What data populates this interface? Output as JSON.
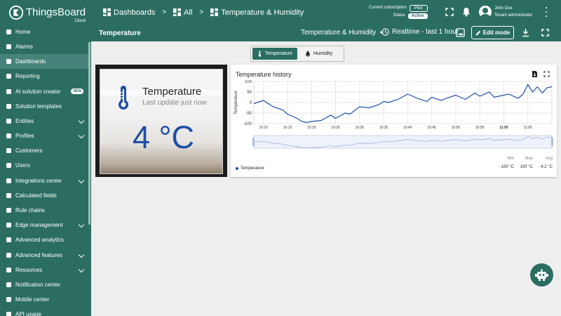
{
  "app": {
    "brand": "ThingsBoard",
    "edition": "Cloud"
  },
  "breadcrumb": [
    {
      "label": "Dashboards",
      "icon": "dashboard-icon"
    },
    {
      "label": "All",
      "icon": "dashboard-icon"
    },
    {
      "label": "Temperature & Humidity",
      "icon": "dashboard-icon"
    }
  ],
  "subscription": {
    "label": "Current subscription",
    "plan": "Pilot",
    "status_label": "Status",
    "status": "Active"
  },
  "user": {
    "name": "John Doe",
    "role": "Tenant administrator"
  },
  "sidebar": {
    "items": [
      {
        "label": "Home",
        "icon": "home-icon",
        "chevron": false
      },
      {
        "label": "Alarms",
        "icon": "alarm-icon",
        "chevron": false
      },
      {
        "label": "Dashboards",
        "icon": "dashboard-icon",
        "chevron": false,
        "active": true
      },
      {
        "label": "Reporting",
        "icon": "report-icon",
        "chevron": false
      },
      {
        "label": "AI solution creator",
        "icon": "ai-icon",
        "chevron": false,
        "badge": "NEW"
      },
      {
        "label": "Solution templates",
        "icon": "template-icon",
        "chevron": false
      },
      {
        "label": "Entities",
        "icon": "entities-icon",
        "chevron": true
      },
      {
        "label": "Profiles",
        "icon": "profiles-icon",
        "chevron": true
      },
      {
        "label": "Customers",
        "icon": "customers-icon",
        "chevron": false
      },
      {
        "label": "Users",
        "icon": "users-icon",
        "chevron": false
      },
      {
        "label": "Integrations center",
        "icon": "integrations-icon",
        "chevron": true
      },
      {
        "label": "Calculated fields",
        "icon": "calculator-icon",
        "chevron": false
      },
      {
        "label": "Rule chains",
        "icon": "rule-chain-icon",
        "chevron": false
      },
      {
        "label": "Edge management",
        "icon": "edge-icon",
        "chevron": true
      },
      {
        "label": "Advanced analytics",
        "icon": "analytics-icon",
        "chevron": false
      },
      {
        "label": "Advanced features",
        "icon": "tools-icon",
        "chevron": true
      },
      {
        "label": "Resources",
        "icon": "folder-icon",
        "chevron": true
      },
      {
        "label": "Notification center",
        "icon": "notification-icon",
        "chevron": false
      },
      {
        "label": "Mobile center",
        "icon": "mobile-icon",
        "chevron": false
      },
      {
        "label": "API usage",
        "icon": "api-icon",
        "chevron": false
      }
    ]
  },
  "dashboard": {
    "title": "Temperature",
    "state": "Temperature & Humidity",
    "timewindow": "Realtime - last 1 hour",
    "edit_label": "Edit mode"
  },
  "tabs": [
    {
      "label": "Temperature",
      "icon": "thermometer-icon",
      "active": true
    },
    {
      "label": "Humidity",
      "icon": "water-drop-icon",
      "active": false
    }
  ],
  "temperature_card": {
    "title": "Temperature",
    "subtitle": "Last update just now",
    "value": "4 °C"
  },
  "history_card": {
    "title": "Temperature history",
    "legend": "Temperature",
    "stats": [
      {
        "label": "Min",
        "value": "-100 °C"
      },
      {
        "label": "Max",
        "value": "100 °C"
      },
      {
        "label": "Avg",
        "value": "-4.2 °C"
      }
    ]
  },
  "colors": {
    "primary": "#2b6e61",
    "series": "#1d4fa8"
  },
  "chart_data": {
    "type": "line",
    "title": "Temperature history",
    "ylabel": "Temperature",
    "ylim": [
      -100,
      100
    ],
    "yticks": [
      100,
      50,
      0,
      -50,
      -100
    ],
    "xticks": [
      "10:10",
      "10:15",
      "10:20",
      "10:25",
      "10:30",
      "10:35",
      "10:40",
      "10:45",
      "10:50",
      "10:55",
      "11:00",
      "11:05"
    ],
    "x_range": [
      "10:08",
      "11:10"
    ],
    "series": [
      {
        "name": "Temperature",
        "x": [
          "10:08",
          "10:10",
          "10:12",
          "10:14",
          "10:15",
          "10:17",
          "10:18",
          "10:19",
          "10:20",
          "10:22",
          "10:24",
          "10:25",
          "10:27",
          "10:28",
          "10:30",
          "10:32",
          "10:34",
          "10:35",
          "10:36",
          "10:38",
          "10:40",
          "10:42",
          "10:44",
          "10:45",
          "10:47",
          "10:48",
          "10:50",
          "10:52",
          "10:54",
          "10:55",
          "10:57",
          "10:58",
          "11:00",
          "11:01",
          "11:03",
          "11:04",
          "11:05",
          "11:06",
          "11:07",
          "11:08",
          "11:09",
          "11:10"
        ],
        "values": [
          -5,
          10,
          -20,
          -35,
          -55,
          -75,
          -90,
          -95,
          -90,
          -85,
          -60,
          -75,
          -50,
          -55,
          -20,
          -25,
          -10,
          5,
          0,
          15,
          40,
          20,
          5,
          25,
          10,
          20,
          35,
          15,
          45,
          30,
          50,
          25,
          35,
          40,
          20,
          40,
          85,
          50,
          75,
          45,
          70,
          75
        ]
      }
    ],
    "grid": true
  }
}
